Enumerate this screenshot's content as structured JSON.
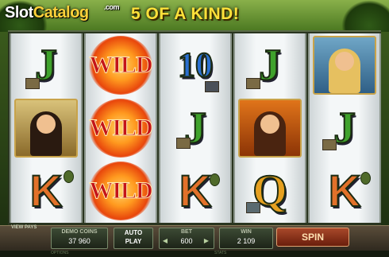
{
  "header": {
    "logo_slot": "Slot",
    "logo_catalog": "Catalog",
    "logo_com": ".com",
    "win_message": "5 OF A KIND!"
  },
  "reels": [
    [
      "J",
      "portrait-dark-haired-woman",
      "K"
    ],
    [
      "WILD",
      "WILD",
      "WILD"
    ],
    [
      "10",
      "J",
      "K"
    ],
    [
      "J",
      "portrait-brown-haired-woman",
      "Q"
    ],
    [
      "portrait-blonde-woman",
      "J",
      "K"
    ]
  ],
  "wild_label": "WILD",
  "controls": {
    "view_pays": "VIEW PAYS",
    "demo_coins_label": "DEMO COINS",
    "demo_coins_value": "37 960",
    "auto_play_line1": "AUTO",
    "auto_play_line2": "PLAY",
    "bet_label": "BET",
    "bet_value": "600",
    "win_label": "WIN",
    "win_value": "2 109",
    "spin_label": "SPIN"
  },
  "footer": {
    "options": "OPTIONS",
    "stats": "STATS"
  },
  "colors": {
    "win_banner": "#ffe13a",
    "j_symbol": "#3fa22c",
    "k_symbol": "#e2712a",
    "q_symbol": "#e6a020",
    "ten_symbol": "#2a6fd0",
    "wild_text": "#c4141a",
    "spin_button": "#8a3418"
  }
}
